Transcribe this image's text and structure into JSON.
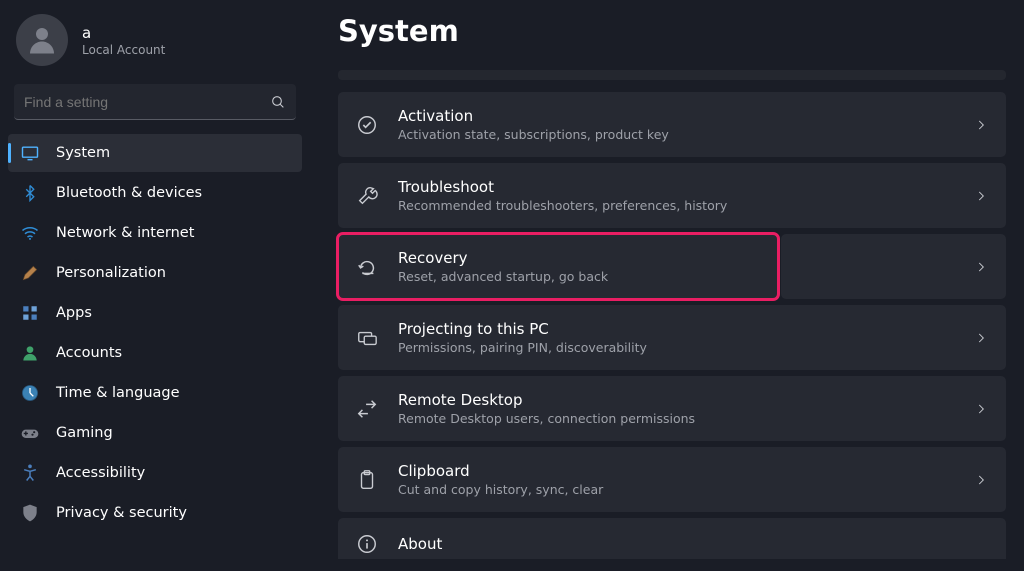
{
  "user": {
    "name": "a",
    "subtitle": "Local Account"
  },
  "search": {
    "placeholder": "Find a setting"
  },
  "nav": [
    {
      "label": "System",
      "active": true,
      "icon": "system"
    },
    {
      "label": "Bluetooth & devices",
      "icon": "bluetooth"
    },
    {
      "label": "Network & internet",
      "icon": "wifi"
    },
    {
      "label": "Personalization",
      "icon": "personalization"
    },
    {
      "label": "Apps",
      "icon": "apps"
    },
    {
      "label": "Accounts",
      "icon": "accounts"
    },
    {
      "label": "Time & language",
      "icon": "time"
    },
    {
      "label": "Gaming",
      "icon": "gaming"
    },
    {
      "label": "Accessibility",
      "icon": "accessibility"
    },
    {
      "label": "Privacy & security",
      "icon": "privacy"
    }
  ],
  "page": {
    "title": "System"
  },
  "settings": [
    {
      "title": "Activation",
      "sub": "Activation state, subscriptions, product key",
      "icon": "activation"
    },
    {
      "title": "Troubleshoot",
      "sub": "Recommended troubleshooters, preferences, history",
      "icon": "troubleshoot"
    },
    {
      "title": "Recovery",
      "sub": "Reset, advanced startup, go back",
      "icon": "recovery",
      "highlighted": true
    },
    {
      "title": "Projecting to this PC",
      "sub": "Permissions, pairing PIN, discoverability",
      "icon": "projecting"
    },
    {
      "title": "Remote Desktop",
      "sub": "Remote Desktop users, connection permissions",
      "icon": "remote"
    },
    {
      "title": "Clipboard",
      "sub": "Cut and copy history, sync, clear",
      "icon": "clipboard"
    },
    {
      "title": "About",
      "sub": "",
      "icon": "about",
      "partial": true
    }
  ]
}
